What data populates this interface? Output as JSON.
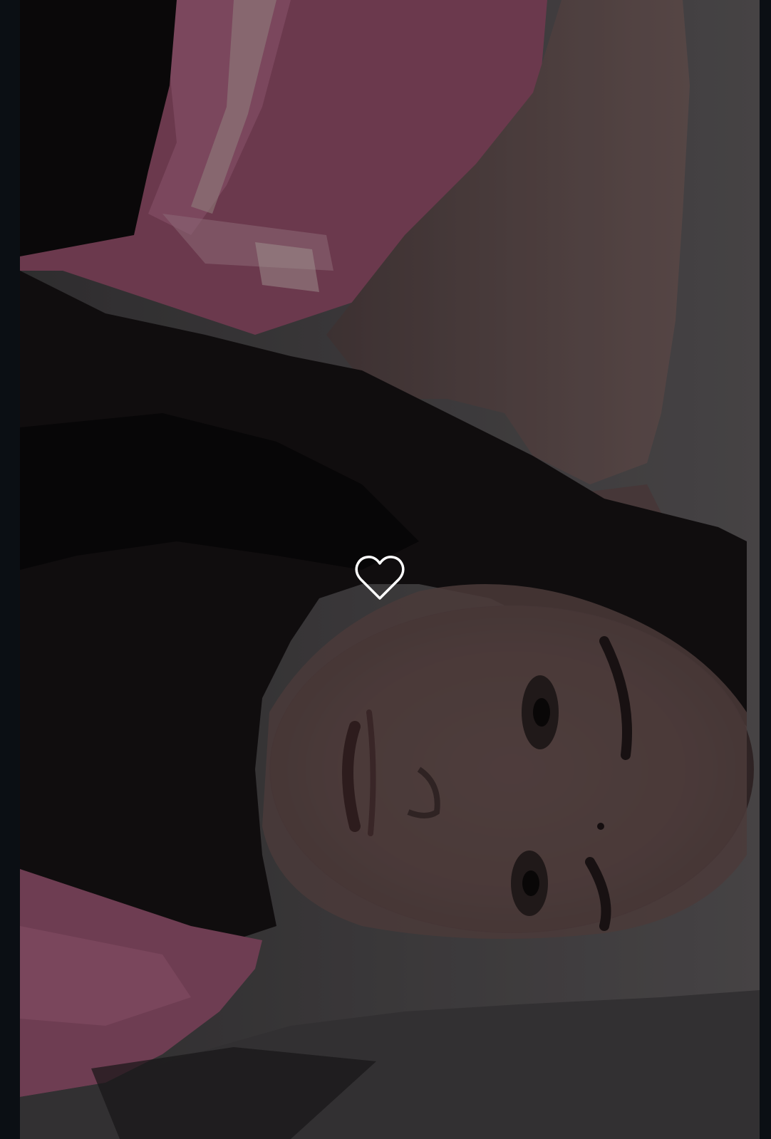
{
  "viewer": {
    "background_color": "#0b0f14"
  },
  "photo": {
    "orientation": "rotated-90-clockwise",
    "dominant_colors": [
      "#1a1416",
      "#b46a86",
      "#5b5558",
      "#3a3538"
    ]
  },
  "like_button": {
    "icon": "heart-outline-icon",
    "liked": false,
    "stroke_color": "#ffffff"
  }
}
